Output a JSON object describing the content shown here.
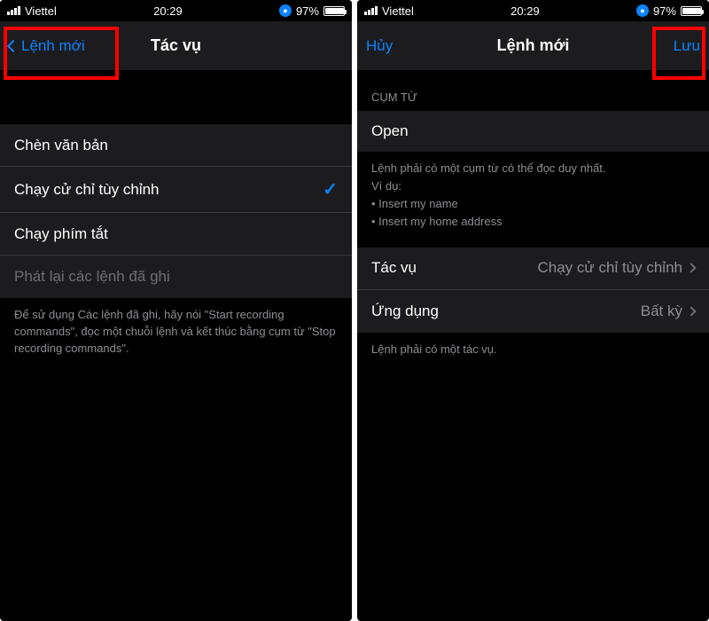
{
  "status": {
    "carrier": "Viettel",
    "time": "20:29",
    "battery_pct": "97%"
  },
  "left": {
    "nav_back": "Lệnh mới",
    "nav_title": "Tác vụ",
    "rows": {
      "insert_text": "Chèn văn bản",
      "run_custom_gesture": "Chạy cử chỉ tùy chỉnh",
      "run_shortcut": "Chạy phím tắt",
      "playback_recorded": "Phát lại các lệnh đã ghi"
    },
    "footer": "Để sử dụng Các lệnh đã ghi, hãy nói \"Start recording commands\", đọc một chuỗi lệnh và kết thúc bằng cụm từ \"Stop recording commands\"."
  },
  "right": {
    "nav_cancel": "Hủy",
    "nav_title": "Lệnh mới",
    "nav_save": "Lưu",
    "section_phrase": "CỤM TỪ",
    "phrase_value": "Open",
    "hint_line1": "Lệnh phải có một cụm từ có thể đọc duy nhất.",
    "hint_line2": "Ví dụ:",
    "hint_bullet1": "• Insert my name",
    "hint_bullet2": "• Insert my home address",
    "action_label": "Tác vụ",
    "action_value": "Chạy cử chỉ tùy chỉnh",
    "app_label": "Ứng dụng",
    "app_value": "Bất kỳ",
    "footer": "Lệnh phải có một tác vụ."
  }
}
